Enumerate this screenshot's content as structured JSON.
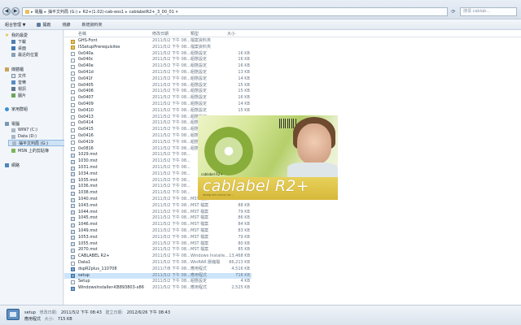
{
  "address": {
    "segments": [
      "電腦",
      "抽平文判局 (G:)",
      "R2+(1.02)-cab-eos1",
      "cablabelR2+_3_00_01"
    ],
    "search_placeholder": "搜尋 cablab..."
  },
  "toolbar": {
    "organize": "組合管理 ▼",
    "open": "開啟",
    "burn": "燒錄",
    "new_folder": "新增資料夾"
  },
  "nav": {
    "favorites": "我的最愛",
    "downloads": "下載",
    "desktop": "桌面",
    "recent": "最近的位置",
    "libraries": "媒體櫃",
    "documents": "文件",
    "music": "音樂",
    "videos": "視訊",
    "pictures": "圖片",
    "homegroup": "家用群組",
    "computer": "電腦",
    "win7": "WIN7 (C:)",
    "data": "Data (D:)",
    "removable": "抽平文判局 (G:)",
    "msn": "MSN 上的剪貼簿",
    "network": "網路"
  },
  "columns": {
    "name": "名稱",
    "date": "修改日期",
    "type": "類型",
    "size": "大小"
  },
  "files": [
    {
      "name": "GHS-Font",
      "date": "2011/5/2 下午 08...",
      "type": "檔案資料夾",
      "size": "",
      "kind": "fold"
    },
    {
      "name": "ISSetupPrerequisites",
      "date": "2011/5/2 下午 08...",
      "type": "檔案資料夾",
      "size": "",
      "kind": "fold"
    },
    {
      "name": "0x040a",
      "date": "2011/5/2 下午 08...",
      "type": "組態設定",
      "size": "16 KB",
      "kind": "file"
    },
    {
      "name": "0x040c",
      "date": "2011/5/2 下午 08...",
      "type": "組態設定",
      "size": "16 KB",
      "kind": "file"
    },
    {
      "name": "0x040e",
      "date": "2011/5/2 下午 08...",
      "type": "組態設定",
      "size": "16 KB",
      "kind": "file"
    },
    {
      "name": "0x041d",
      "date": "2011/5/2 下午 08...",
      "type": "組態設定",
      "size": "13 KB",
      "kind": "file"
    },
    {
      "name": "0x041f",
      "date": "2011/5/2 下午 08...",
      "type": "組態設定",
      "size": "14 KB",
      "kind": "file"
    },
    {
      "name": "0x0405",
      "date": "2011/5/2 下午 08...",
      "type": "組態設定",
      "size": "15 KB",
      "kind": "file"
    },
    {
      "name": "0x0406",
      "date": "2011/5/2 下午 08...",
      "type": "組態設定",
      "size": "15 KB",
      "kind": "file"
    },
    {
      "name": "0x0407",
      "date": "2011/5/2 下午 08...",
      "type": "組態設定",
      "size": "16 KB",
      "kind": "file"
    },
    {
      "name": "0x0409",
      "date": "2011/5/2 下午 08...",
      "type": "組態設定",
      "size": "14 KB",
      "kind": "file"
    },
    {
      "name": "0x0410",
      "date": "2011/5/2 下午 08...",
      "type": "組態設定",
      "size": "15 KB",
      "kind": "file"
    },
    {
      "name": "0x0413",
      "date": "2011/5/2 下午 08...",
      "type": "組態設定",
      "size": "",
      "kind": "file"
    },
    {
      "name": "0x0414",
      "date": "2011/5/2 下午 08...",
      "type": "組態設定",
      "size": "",
      "kind": "file"
    },
    {
      "name": "0x0415",
      "date": "2011/5/2 下午 08...",
      "type": "組態設定",
      "size": "",
      "kind": "file"
    },
    {
      "name": "0x0416",
      "date": "2011/5/2 下午 08...",
      "type": "組態設定",
      "size": "",
      "kind": "file"
    },
    {
      "name": "0x0419",
      "date": "2011/5/2 下午 08...",
      "type": "組態設定",
      "size": "",
      "kind": "file"
    },
    {
      "name": "0x0816",
      "date": "2011/5/2 下午 08...",
      "type": "組態設定",
      "size": "",
      "kind": "file"
    },
    {
      "name": "1029.mst",
      "date": "2011/5/2 下午 08...",
      "type": "",
      "size": "",
      "kind": "msi"
    },
    {
      "name": "1030.mst",
      "date": "2011/5/2 下午 08...",
      "type": "",
      "size": "",
      "kind": "msi"
    },
    {
      "name": "1031.mst",
      "date": "2011/5/2 下午 08...",
      "type": "",
      "size": "",
      "kind": "msi"
    },
    {
      "name": "1034.mst",
      "date": "2011/5/2 下午 08...",
      "type": "",
      "size": "",
      "kind": "msi"
    },
    {
      "name": "1035.mst",
      "date": "2011/5/2 下午 08...",
      "type": "",
      "size": "",
      "kind": "msi"
    },
    {
      "name": "1036.mst",
      "date": "2011/5/2 下午 08...",
      "type": "",
      "size": "",
      "kind": "msi"
    },
    {
      "name": "1038.mst",
      "date": "2011/5/2 下午 08...",
      "type": "",
      "size": "",
      "kind": "msi"
    },
    {
      "name": "1040.mst",
      "date": "2011/5/2 下午 08...",
      "type": "MST 檔案",
      "size": "112 KB",
      "kind": "msi"
    },
    {
      "name": "1043.mst",
      "date": "2011/5/2 下午 08...",
      "type": "MST 檔案",
      "size": "88 KB",
      "kind": "msi"
    },
    {
      "name": "1044.mst",
      "date": "2011/5/2 下午 08...",
      "type": "MST 檔案",
      "size": "79 KB",
      "kind": "msi"
    },
    {
      "name": "1045.mst",
      "date": "2011/5/2 下午 08...",
      "type": "MST 檔案",
      "size": "86 KB",
      "kind": "msi"
    },
    {
      "name": "1046.mst",
      "date": "2011/5/2 下午 08...",
      "type": "MST 檔案",
      "size": "84 KB",
      "kind": "msi"
    },
    {
      "name": "1049.mst",
      "date": "2011/5/2 下午 08...",
      "type": "MST 檔案",
      "size": "83 KB",
      "kind": "msi"
    },
    {
      "name": "1053.mst",
      "date": "2011/5/2 下午 08...",
      "type": "MST 檔案",
      "size": "79 KB",
      "kind": "msi"
    },
    {
      "name": "1055.mst",
      "date": "2011/5/2 下午 08...",
      "type": "MST 檔案",
      "size": "80 KB",
      "kind": "msi"
    },
    {
      "name": "2070.mst",
      "date": "2011/5/2 下午 08...",
      "type": "MST 檔案",
      "size": "85 KB",
      "kind": "msi"
    },
    {
      "name": "CABLABEL R2+",
      "date": "2011/5/2 下午 08...",
      "type": "Windows Installe...",
      "size": "13,468 KB",
      "kind": "msi"
    },
    {
      "name": "Data1",
      "date": "2011/5/2 下午 08...",
      "type": "WinRAR 壓縮檔",
      "size": "66,213 KB",
      "kind": "file"
    },
    {
      "name": "dspR2plus_110708",
      "date": "2011/7/8 下午 08...",
      "type": "應用程式",
      "size": "4,516 KB",
      "kind": "exe"
    },
    {
      "name": "setup",
      "date": "2011/5/2 下午 08...",
      "type": "應用程式",
      "size": "716 KB",
      "kind": "exe",
      "selected": true
    },
    {
      "name": "Setup",
      "date": "2011/5/2 下午 08...",
      "type": "組態設定",
      "size": "4 KB",
      "kind": "file"
    },
    {
      "name": "WindowsInstaller-KB893803-x86",
      "date": "2011/5/2 下午 08...",
      "type": "應用程式",
      "size": "2,525 KB",
      "kind": "exe"
    }
  ],
  "splash": {
    "version": "cablabel R2+",
    "brand": "cablabel R2+",
    "tagline": "designed mainly for..."
  },
  "details": {
    "name": "setup",
    "modified_label": "修改日期:",
    "modified": "2011/5/2 下午 08:43",
    "created_label": "建立日期:",
    "created": "2012/6/26 下午 08:43",
    "type": "應用程式",
    "size_label": "大小:",
    "size": "715 KB"
  },
  "colors": {
    "selection": "#cde5fb",
    "folder": "#e8c25a",
    "splash_band": "#e0c64a"
  }
}
